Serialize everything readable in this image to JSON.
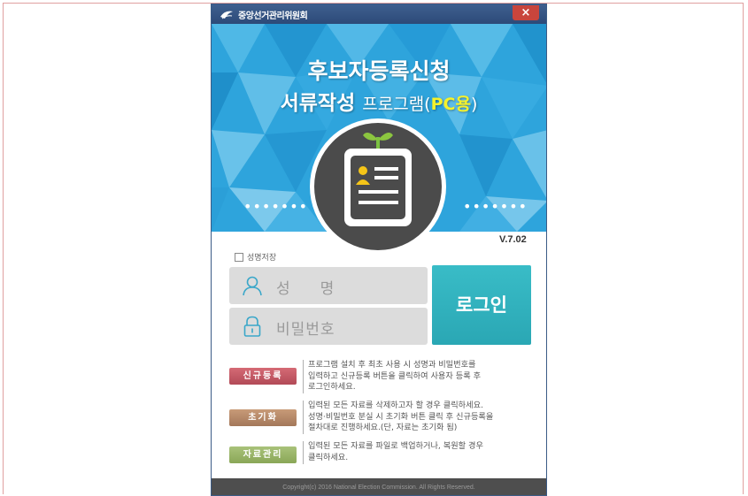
{
  "window": {
    "title": "중앙선거관리위원회",
    "close_label": "×"
  },
  "hero": {
    "title_line1": "후보자등록신청",
    "title_line2_part1": "서류작성 ",
    "title_line2_part2": "프로그램(",
    "title_line2_part3": "PC용",
    "title_line2_part4": ")",
    "dots_left": "•••••••",
    "dots_right": "•••••••"
  },
  "version": "V.7.02",
  "login": {
    "save_name_label": "성명저장",
    "name_placeholder": "성명",
    "password_placeholder": "비밀번호",
    "login_button": "로그인"
  },
  "actions": [
    {
      "label": "신규등록",
      "description": "프로그램 설치 후 최초 사용 시 성명과 비밀번호를\n입력하고 신규등록 버튼을 클릭하여 사용자 등록 후\n로그인하세요."
    },
    {
      "label": "초기화",
      "description": "입력된 모든 자료를 삭제하고자 할 경우 클릭하세요.\n성명·비밀번호 분실 시 초기화 버튼 클릭 후 신규등록을\n절차대로 진행하세요.(단, 자료는 초기화 됨)"
    },
    {
      "label": "자료관리",
      "description": "입력된 모든 자료를 파일로 백업하거나, 복원할 경우\n클릭하세요."
    }
  ],
  "footer": "Copyright(c) 2016 National Election Commission. All Rights Reserved.",
  "colors": {
    "hero_blue": "#2ea4dc",
    "login_teal": "#2aa7b4",
    "register_red": "#b24a57",
    "reset_brown": "#a3775a",
    "manage_green": "#8aa757",
    "accent_yellow": "#f5f22b"
  }
}
